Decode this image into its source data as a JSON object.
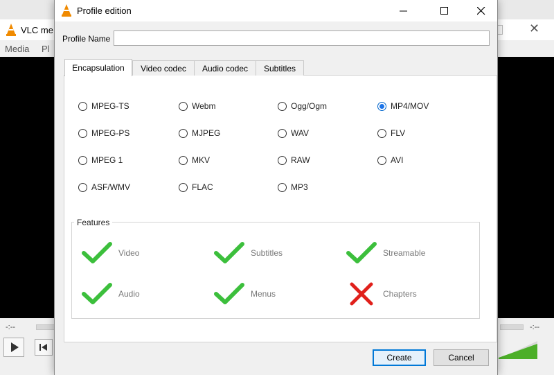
{
  "background_window": {
    "title": "VLC me",
    "menus": [
      "Media",
      "Pl"
    ],
    "time_left": "-:--",
    "time_right": "-:--"
  },
  "dialog": {
    "title": "Profile edition",
    "profile_name_label": "Profile Name",
    "profile_name_value": "",
    "tabs": [
      {
        "label": "Encapsulation",
        "active": true
      },
      {
        "label": "Video codec",
        "active": false
      },
      {
        "label": "Audio codec",
        "active": false
      },
      {
        "label": "Subtitles",
        "active": false
      }
    ],
    "encapsulation_options": [
      {
        "label": "MPEG-TS",
        "selected": false
      },
      {
        "label": "Webm",
        "selected": false
      },
      {
        "label": "Ogg/Ogm",
        "selected": false
      },
      {
        "label": "MP4/MOV",
        "selected": true
      },
      {
        "label": "MPEG-PS",
        "selected": false
      },
      {
        "label": "MJPEG",
        "selected": false
      },
      {
        "label": "WAV",
        "selected": false
      },
      {
        "label": "FLV",
        "selected": false
      },
      {
        "label": "MPEG 1",
        "selected": false
      },
      {
        "label": "MKV",
        "selected": false
      },
      {
        "label": "RAW",
        "selected": false
      },
      {
        "label": "AVI",
        "selected": false
      },
      {
        "label": "ASF/WMV",
        "selected": false
      },
      {
        "label": "FLAC",
        "selected": false
      },
      {
        "label": "MP3",
        "selected": false
      }
    ],
    "features_title": "Features",
    "features": [
      {
        "label": "Video",
        "supported": true,
        "icon": "check-icon"
      },
      {
        "label": "Subtitles",
        "supported": true,
        "icon": "check-icon"
      },
      {
        "label": "Streamable",
        "supported": true,
        "icon": "check-icon"
      },
      {
        "label": "Audio",
        "supported": true,
        "icon": "check-icon"
      },
      {
        "label": "Menus",
        "supported": true,
        "icon": "check-icon"
      },
      {
        "label": "Chapters",
        "supported": false,
        "icon": "cross-icon"
      }
    ],
    "buttons": {
      "create": "Create",
      "cancel": "Cancel"
    }
  },
  "colors": {
    "check": "#3cbf3c",
    "cross": "#e0201b",
    "accent": "#0078d7"
  }
}
